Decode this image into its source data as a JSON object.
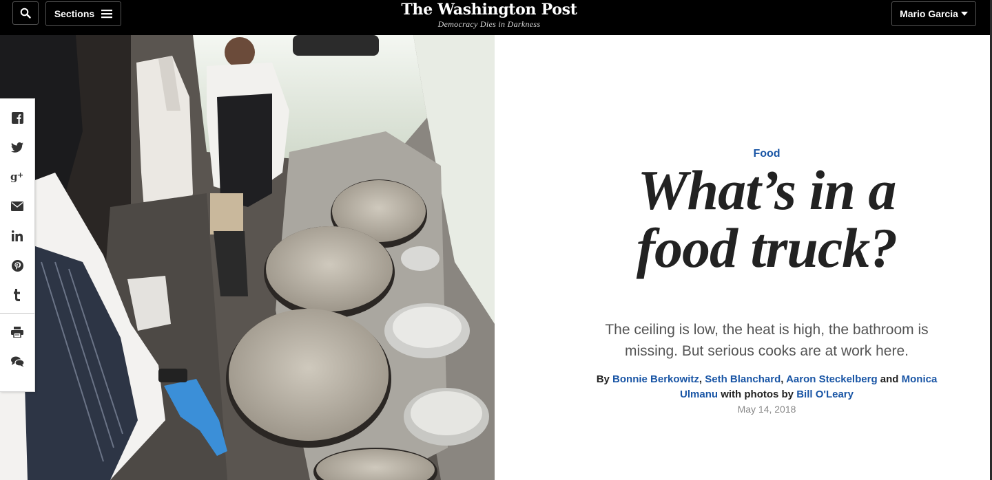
{
  "header": {
    "sections_label": "Sections",
    "brand_name": "The Washington Post",
    "brand_tagline": "Democracy Dies in Darkness",
    "user_name": "Mario Garcia",
    "icons": {
      "search": "search-icon",
      "menu": "hamburger-icon",
      "user_menu": "caret-down-icon"
    }
  },
  "share_rail": {
    "items": [
      "facebook-icon",
      "twitter-icon",
      "google-plus-icon",
      "email-icon",
      "linkedin-icon",
      "pinterest-icon",
      "tumblr-icon",
      "print-icon",
      "comments-icon"
    ]
  },
  "article": {
    "kicker": "Food",
    "headline_line1": "What’s in a",
    "headline_line2": "food truck?",
    "dek": "The ceiling is low, the heat is high, the bathroom is missing. But serious cooks are at work here.",
    "byline": {
      "by": "By",
      "author1": "Bonnie Berkowitz",
      "author2": "Seth Blanchard",
      "author3": "Aaron Steckelberg",
      "and": "and",
      "author4": "Monica Ulmanu",
      "photos_prefix": "with photos by",
      "photographer": "Bill O'Leary"
    },
    "date": "May 14, 2018"
  },
  "colors": {
    "link": "#1955a5",
    "topbar": "#000000",
    "headline": "#222222"
  }
}
